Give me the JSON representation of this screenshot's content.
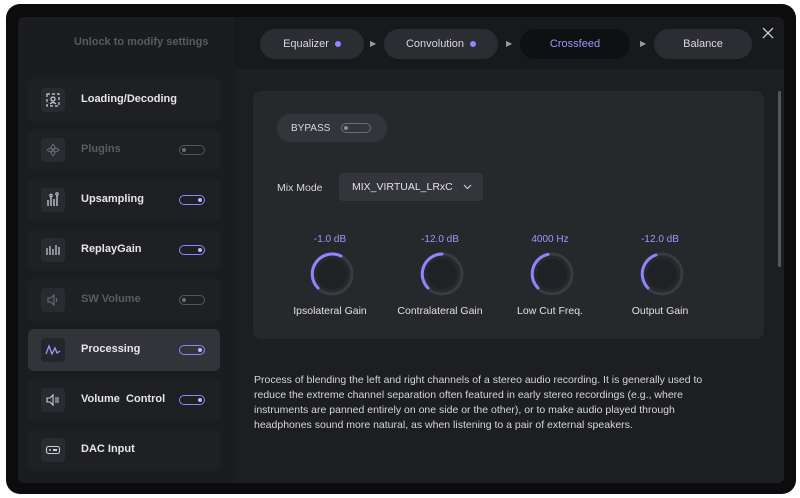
{
  "sidebar": {
    "unlock_text": "Unlock to modify settings",
    "items": [
      {
        "label": "Loading/Decoding",
        "icon": "loading-decoding-icon",
        "toggle": null
      },
      {
        "label": "Plugins",
        "icon": "plugins-icon",
        "toggle": "off"
      },
      {
        "label": "Upsampling",
        "icon": "upsampling-icon",
        "toggle": "on"
      },
      {
        "label": "ReplayGain",
        "icon": "replaygain-icon",
        "toggle": "on"
      },
      {
        "label": "SW Volume",
        "icon": "sw-volume-icon",
        "toggle": "off"
      },
      {
        "label": "Processing",
        "icon": "processing-icon",
        "toggle": "on"
      },
      {
        "label": "Volume  Control",
        "icon": "volume-control-icon",
        "toggle": "on"
      },
      {
        "label": "DAC Input",
        "icon": "dac-input-icon",
        "toggle": null
      }
    ],
    "active": "Processing"
  },
  "tabs": [
    {
      "label": "Equalizer",
      "enabled": true
    },
    {
      "label": "Convolution",
      "enabled": true
    },
    {
      "label": "Crossfeed",
      "active": true
    },
    {
      "label": "Balance"
    }
  ],
  "panel": {
    "bypass_label": "BYPASS",
    "bypass_on": false,
    "mix_mode_label": "Mix Mode",
    "mix_mode_value": "MIX_VIRTUAL_LRxC",
    "knobs": [
      {
        "value": "-1.0 dB",
        "label": "Ipsolateral Gain"
      },
      {
        "value": "-12.0 dB",
        "label": "Contralateral Gain"
      },
      {
        "value": "4000 Hz",
        "label": "Low Cut Freq."
      },
      {
        "value": "-12.0 dB",
        "label": "Output Gain"
      }
    ]
  },
  "description": "Process of blending the left and right channels of a stereo audio recording. It is generally used to reduce the extreme channel separation often featured in early stereo recordings (e.g., where instruments are panned entirely on one side or the other), or to make audio played through headphones sound more natural, as when listening to a pair of external speakers.",
  "colors": {
    "accent": "#8d86ff",
    "background": "#1d1e21",
    "sidebar": "#1b1c1f",
    "panel": "#27282c"
  }
}
